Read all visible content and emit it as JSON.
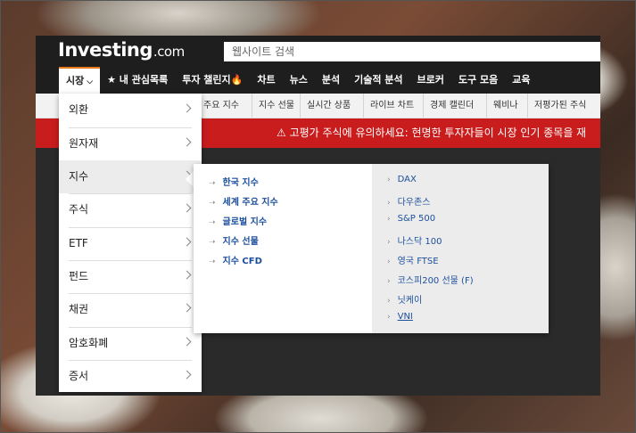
{
  "header": {
    "logo_main": "Investing",
    "logo_suffix": ".com",
    "search_placeholder": "웹사이트 검색"
  },
  "main_nav": [
    {
      "label": "시장",
      "active": true
    },
    {
      "label": "★ 내 관심목록"
    },
    {
      "label": "투자 챌린지🔥"
    },
    {
      "label": "차트"
    },
    {
      "label": "뉴스"
    },
    {
      "label": "분석"
    },
    {
      "label": "기술적 분석"
    },
    {
      "label": "브로커"
    },
    {
      "label": "도구 모음"
    },
    {
      "label": "교육"
    }
  ],
  "sub_nav": [
    "주요 지수",
    "지수 선물",
    "실시간 상품",
    "라이브 차트",
    "경제 캘린더",
    "웨비나",
    "저평가된 주식"
  ],
  "alert_banner": "⚠ 고평가 주식에 유의하세요: 현명한 투자자들이 시장 인기 종목을 재",
  "market_menu": [
    "외환",
    "원자재",
    "지수",
    "주식",
    "ETF",
    "펀드",
    "채권",
    "암호화폐",
    "증서"
  ],
  "market_menu_highlight": "지수",
  "indices_submenu": {
    "categories": [
      "한국 지수",
      "세계 주요 지수",
      "글로벌 지수",
      "지수 선물",
      "지수 CFD"
    ],
    "popular": [
      "DAX",
      "다우존스",
      "S&P 500",
      "나스닥 100",
      "영국 FTSE",
      "코스피200 선물 (F)",
      "닛케이",
      "VNI"
    ]
  },
  "colors": {
    "alert_red": "#c91d1d",
    "accent_orange": "#f26d00",
    "link_blue": "#1b4f9c",
    "nav_dark": "#1e1e1e"
  }
}
